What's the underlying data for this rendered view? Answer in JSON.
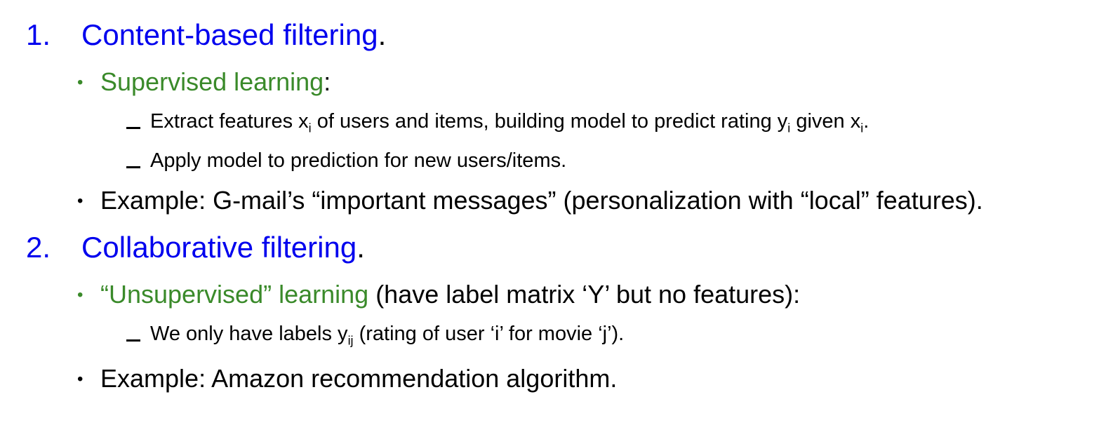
{
  "colors": {
    "heading": "#0000EE",
    "green": "#3A8A2A",
    "text": "#000000"
  },
  "section1": {
    "number": "1.",
    "title": "Content-based filtering",
    "title_end": ".",
    "bullet1": {
      "highlight": "Supervised learning",
      "rest": ":"
    },
    "sub1": {
      "a": "Extract features x",
      "a_sub": "i",
      "b": " of users and items, building model to predict rating y",
      "b_sub": "i",
      "c": " given x",
      "c_sub": "i",
      "d": "."
    },
    "sub2": "Apply model to prediction for new users/items.",
    "bullet2": "Example: G-mail’s “important messages” (personalization with “local” features)."
  },
  "section2": {
    "number": "2.",
    "title": "Collaborative filtering",
    "title_end": ".",
    "bullet1": {
      "highlight": "“Unsupervised” learning",
      "rest": " (have label matrix ‘Y’ but no features):"
    },
    "sub1": {
      "a": "We only have labels y",
      "a_sub": "ij",
      "b": " (rating of user ‘i’ for movie ‘j’)."
    },
    "bullet2": "Example: Amazon recommendation algorithm."
  },
  "bullet_glyph": "•"
}
